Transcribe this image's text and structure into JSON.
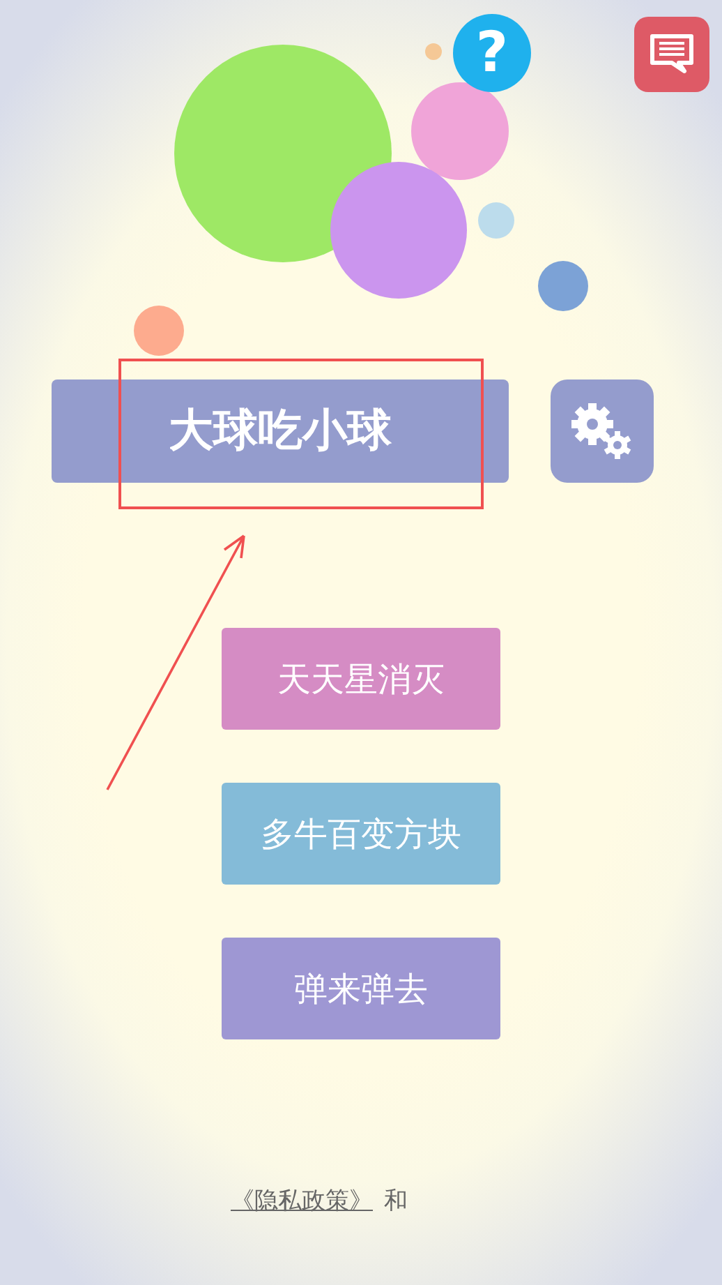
{
  "help_button": {
    "label": "?"
  },
  "title_button": {
    "label": "大球吃小球"
  },
  "games": [
    {
      "label": "天天星消灭",
      "color": "#d58cc4"
    },
    {
      "label": "多牛百变方块",
      "color": "#84bbd8"
    },
    {
      "label": "弹来弹去",
      "color": "#9e97d3"
    }
  ],
  "footer": {
    "privacy_link": "《隐私政策》",
    "conjunction": "和"
  }
}
